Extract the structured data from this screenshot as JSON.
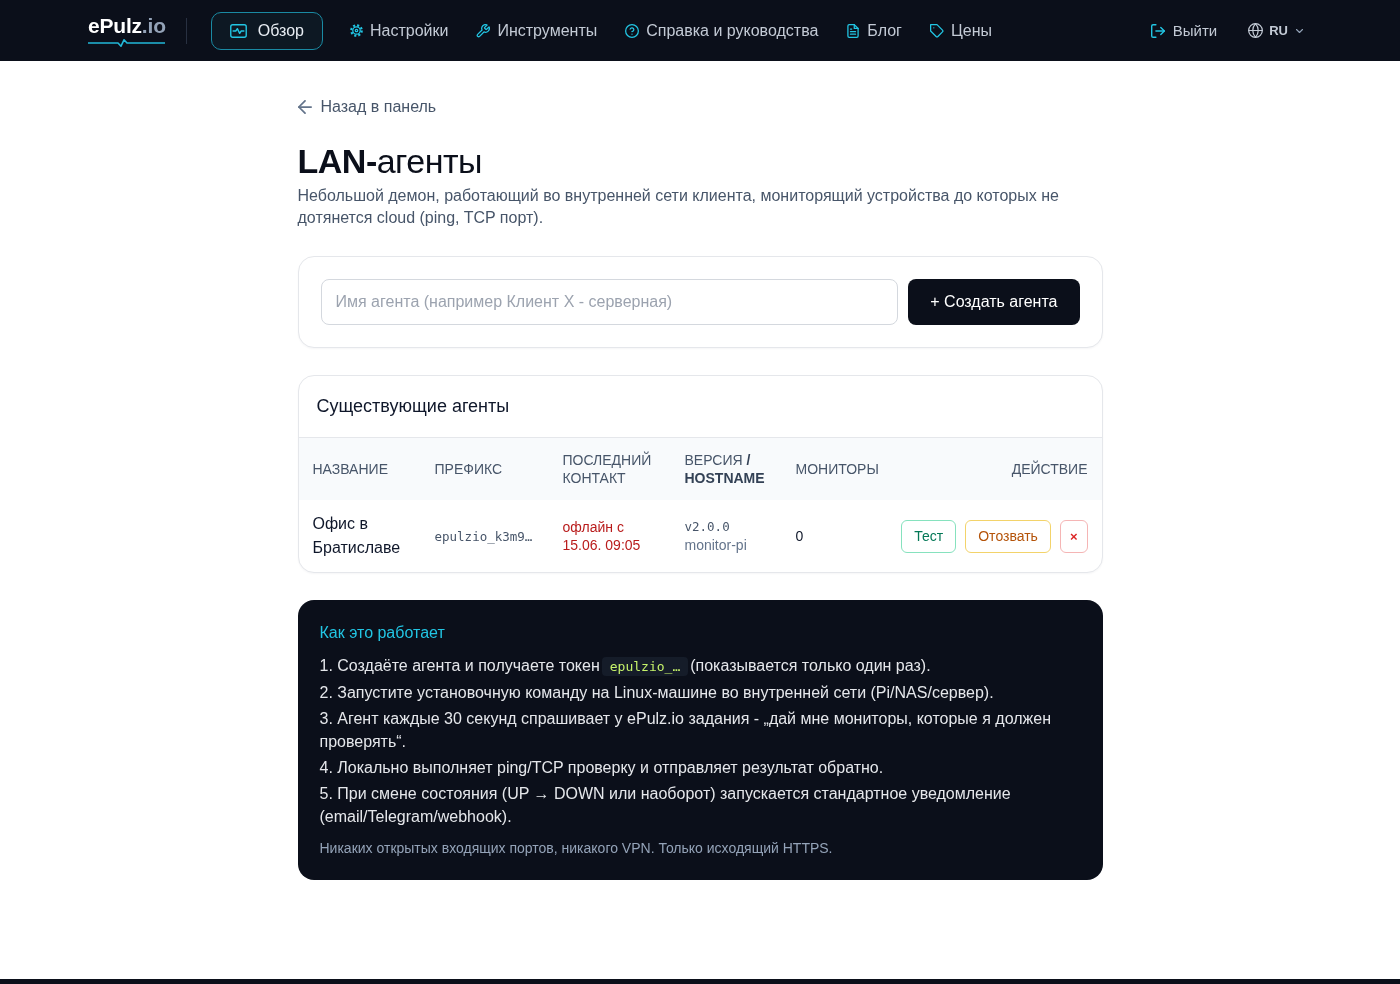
{
  "nav": {
    "logo": {
      "name": "ePulz",
      "suffix": ".io"
    },
    "items": [
      {
        "kind": "overview",
        "label": "Обзор",
        "selected": true
      },
      {
        "kind": "settings",
        "label": "Настройки",
        "selected": false
      },
      {
        "kind": "tools",
        "label": "Инструменты",
        "selected": false
      },
      {
        "kind": "help",
        "label": "Справка и руководства",
        "selected": false
      },
      {
        "kind": "blog",
        "label": "Блог",
        "selected": false
      },
      {
        "kind": "pricing",
        "label": "Цены",
        "selected": false
      }
    ],
    "logout": "Выйти",
    "language": "RU"
  },
  "back_link": "Назад в панель",
  "page": {
    "title": "**LAN-**агенты",
    "description": "Небольшой демон, работающий во внутренней сети клиента, мониторящий устройства до которых не дотянется cloud (ping, TCP порт)."
  },
  "create_form": {
    "placeholder": "Имя агента (например Клиент X - серверная)",
    "button": "+ Создать агента"
  },
  "agents": {
    "title": "Существующие агенты",
    "columns": [
      "НАЗВАНИЕ",
      "ПРЕФИКС",
      "ПОСЛЕДНИЙ КОНТАКТ",
      "ВЕРСИЯ **/ HOSTNAME**",
      "МОНИТОРЫ",
      "ДЕЙСТВИЕ"
    ],
    "rows": [
      {
        "name": "Офис в Братиславе",
        "prefix": "epulzio_k3m9…",
        "last_contact": "офлайн с 15.06. 09:05",
        "online": false,
        "version": "v2.0.0",
        "hostname": "monitor-pi",
        "monitors": "0",
        "actions": [
          {
            "kind": "test",
            "label": "Тест"
          },
          {
            "kind": "revoke",
            "label": "Отозвать"
          },
          {
            "kind": "delete",
            "label": "×"
          }
        ]
      }
    ]
  },
  "how_it_works": {
    "title": "Как это работает",
    "steps": [
      {
        "text": "1. Создаёте агента и получаете токен",
        "code": "epulzio_…",
        "after": "(показывается только один раз)."
      },
      {
        "text": "2. Запустите установочную команду на Linux-машине во внутренней сети (Pi/NAS/сервер)."
      },
      {
        "text": "3. Агент каждые 30 секунд спрашивает у ePulz.io задания - „дай мне мониторы, которые я должен проверять“."
      },
      {
        "text": "4. Локально выполняет ping/TCP проверку и отправляет результат обратно."
      },
      {
        "text": "5. При смене состояния (UP → DOWN или наоборот) запускается стандартное уведомление (email/Telegram/webhook)."
      }
    ],
    "note": "Никаких открытых входящих портов, никакого VPN. Только исходящий HTTPS."
  }
}
